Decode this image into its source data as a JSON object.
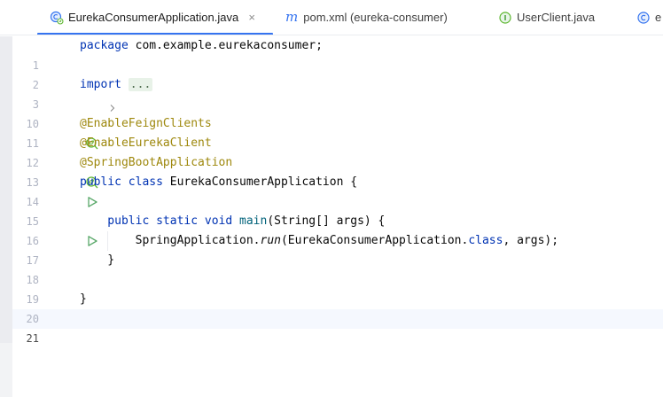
{
  "tabs": [
    {
      "label": "EurekaConsumerApplication.java",
      "icon": "spring-class-icon",
      "active": true,
      "close": "×"
    },
    {
      "label": "pom.xml (eureka-consumer)",
      "icon": "maven-m-icon",
      "glyph": "m",
      "active": false
    },
    {
      "label": "UserClient.java",
      "icon": "interface-icon",
      "active": false
    },
    {
      "label": "e",
      "icon": "class-icon",
      "active": false
    }
  ],
  "editor": {
    "lines": [
      {
        "n": "1",
        "tokens": [
          {
            "t": "package ",
            "c": "kw"
          },
          {
            "t": "com.example.eurekaconsumer;",
            "c": "plain"
          }
        ]
      },
      {
        "n": "2",
        "tokens": []
      },
      {
        "n": "3",
        "fold": true,
        "tokens": [
          {
            "t": "import ",
            "c": "kw"
          },
          {
            "t": "...",
            "c": "folded"
          }
        ]
      },
      {
        "n": "10",
        "tokens": []
      },
      {
        "n": "11",
        "icon": "spring-bean-icon",
        "tokens": [
          {
            "t": "@EnableFeignClients",
            "c": "ann"
          }
        ]
      },
      {
        "n": "12",
        "tokens": [
          {
            "t": "@EnableEurekaClient",
            "c": "ann"
          }
        ]
      },
      {
        "n": "13",
        "icon": "spring-bean-icon",
        "tokens": [
          {
            "t": "@SpringBootApplication",
            "c": "ann"
          }
        ]
      },
      {
        "n": "14",
        "icon": "run-icon",
        "tokens": [
          {
            "t": "public class ",
            "c": "kw"
          },
          {
            "t": "EurekaConsumerApplication {",
            "c": "plain"
          }
        ]
      },
      {
        "n": "15",
        "tokens": []
      },
      {
        "n": "16",
        "icon": "run-icon",
        "tokens": [
          {
            "t": "    public static void ",
            "c": "kw"
          },
          {
            "t": "main",
            "c": "fn"
          },
          {
            "t": "(String[] args) {",
            "c": "plain"
          }
        ]
      },
      {
        "n": "17",
        "guide": true,
        "tokens": [
          {
            "t": "        SpringApplication.",
            "c": "plain"
          },
          {
            "t": "run",
            "c": "it"
          },
          {
            "t": "(EurekaConsumerApplication.",
            "c": "plain"
          },
          {
            "t": "class",
            "c": "kw"
          },
          {
            "t": ", args);",
            "c": "plain"
          }
        ]
      },
      {
        "n": "18",
        "tokens": [
          {
            "t": "    }",
            "c": "plain"
          }
        ]
      },
      {
        "n": "19",
        "tokens": []
      },
      {
        "n": "20",
        "tokens": [
          {
            "t": "}",
            "c": "plain"
          }
        ]
      },
      {
        "n": "21",
        "current": true,
        "tokens": []
      }
    ]
  },
  "colors": {
    "keyword": "#0033b3",
    "annotation": "#9e880d",
    "method": "#00627a",
    "accent": "#3574f0",
    "spring": "#5fb832",
    "run": "#59a869"
  }
}
